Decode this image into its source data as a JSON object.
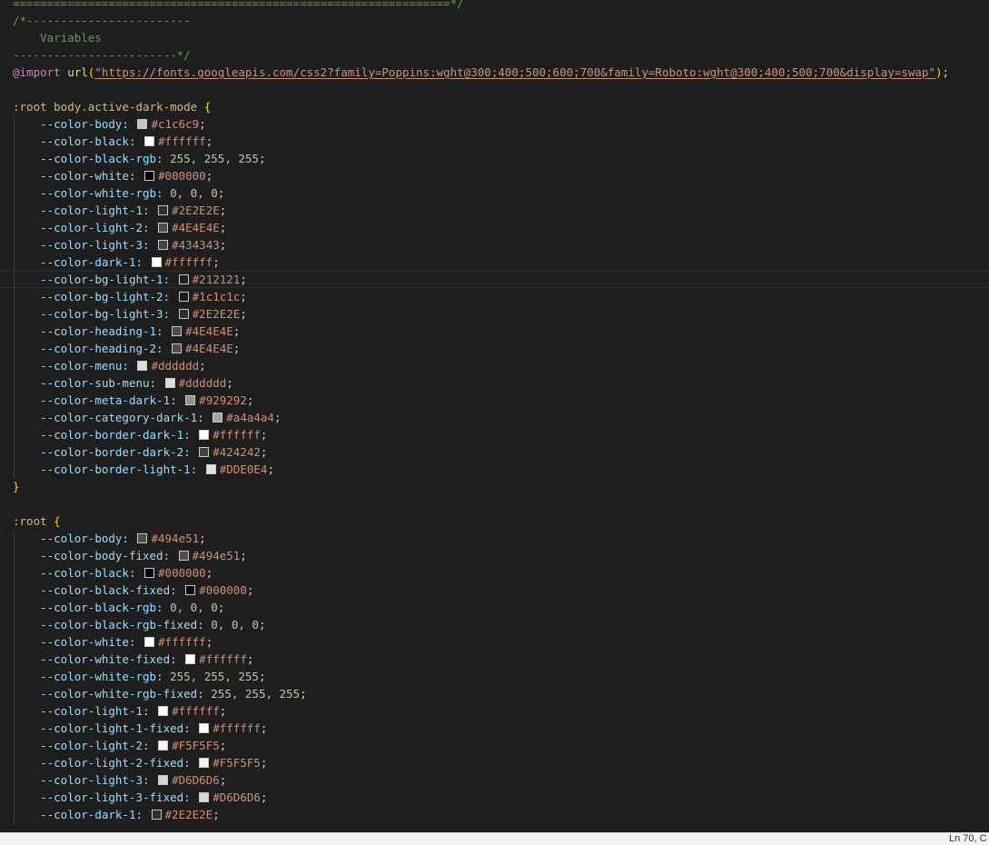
{
  "editor": {
    "lines": [
      {
        "type": "comment",
        "text": "================================================================*/"
      },
      {
        "type": "comment",
        "text": "/*------------------------"
      },
      {
        "type": "comment",
        "text": "    Variables"
      },
      {
        "type": "comment",
        "text": "------------------------*/"
      },
      {
        "type": "import",
        "keyword": "@import",
        "func": "url",
        "url": "\"https://fonts.googleapis.com/css2?family=Poppins:wght@300;400;500;600;700&family=Roboto:wght@300;400;500;700&display=swap\""
      },
      {
        "type": "blank"
      },
      {
        "type": "selector",
        "text": ":root body.active-dark-mode"
      },
      {
        "type": "decl",
        "prop": "--color-body",
        "kind": "color",
        "value": "#c1c6c9",
        "swatch": "#c1c6c9"
      },
      {
        "type": "decl",
        "prop": "--color-black",
        "kind": "color",
        "value": "#ffffff",
        "swatch": "#ffffff"
      },
      {
        "type": "decl",
        "prop": "--color-black-rgb",
        "kind": "number",
        "value": "255, 255, 255"
      },
      {
        "type": "decl",
        "prop": "--color-white",
        "kind": "color",
        "value": "#000000",
        "swatch": "#000000"
      },
      {
        "type": "decl",
        "prop": "--color-white-rgb",
        "kind": "number",
        "value": "0, 0, 0"
      },
      {
        "type": "decl",
        "prop": "--color-light-1",
        "kind": "color",
        "value": "#2E2E2E",
        "swatch": "#2E2E2E"
      },
      {
        "type": "decl",
        "prop": "--color-light-2",
        "kind": "color",
        "value": "#4E4E4E",
        "swatch": "#4E4E4E"
      },
      {
        "type": "decl",
        "prop": "--color-light-3",
        "kind": "color",
        "value": "#434343",
        "swatch": "#434343"
      },
      {
        "type": "decl",
        "prop": "--color-dark-1",
        "kind": "color",
        "value": "#ffffff",
        "swatch": "#ffffff"
      },
      {
        "type": "decl",
        "prop": "--color-bg-light-1",
        "kind": "color",
        "value": "#212121",
        "swatch": "#212121",
        "current": true
      },
      {
        "type": "decl",
        "prop": "--color-bg-light-2",
        "kind": "color",
        "value": "#1c1c1c",
        "swatch": "#1c1c1c"
      },
      {
        "type": "decl",
        "prop": "--color-bg-light-3",
        "kind": "color",
        "value": "#2E2E2E",
        "swatch": "#2E2E2E"
      },
      {
        "type": "decl",
        "prop": "--color-heading-1",
        "kind": "color",
        "value": "#4E4E4E",
        "swatch": "#4E4E4E"
      },
      {
        "type": "decl",
        "prop": "--color-heading-2",
        "kind": "color",
        "value": "#4E4E4E",
        "swatch": "#4E4E4E"
      },
      {
        "type": "decl",
        "prop": "--color-menu",
        "kind": "color",
        "value": "#dddddd",
        "swatch": "#dddddd"
      },
      {
        "type": "decl",
        "prop": "--color-sub-menu",
        "kind": "color",
        "value": "#dddddd",
        "swatch": "#dddddd"
      },
      {
        "type": "decl",
        "prop": "--color-meta-dark-1",
        "kind": "color",
        "value": "#929292",
        "swatch": "#929292"
      },
      {
        "type": "decl",
        "prop": "--color-category-dark-1",
        "kind": "color",
        "value": "#a4a4a4",
        "swatch": "#a4a4a4"
      },
      {
        "type": "decl",
        "prop": "--color-border-dark-1",
        "kind": "color",
        "value": "#ffffff",
        "swatch": "#ffffff"
      },
      {
        "type": "decl",
        "prop": "--color-border-dark-2",
        "kind": "color",
        "value": "#424242",
        "swatch": "#424242"
      },
      {
        "type": "decl",
        "prop": "--color-border-light-1",
        "kind": "color",
        "value": "#DDE0E4",
        "swatch": "#DDE0E4"
      },
      {
        "type": "close",
        "text": "}"
      },
      {
        "type": "blank"
      },
      {
        "type": "selector",
        "text": ":root"
      },
      {
        "type": "decl",
        "prop": "--color-body",
        "kind": "color",
        "value": "#494e51",
        "swatch": "#494e51"
      },
      {
        "type": "decl",
        "prop": "--color-body-fixed",
        "kind": "color",
        "value": "#494e51",
        "swatch": "#494e51"
      },
      {
        "type": "decl",
        "prop": "--color-black",
        "kind": "color",
        "value": "#000000",
        "swatch": "#000000"
      },
      {
        "type": "decl",
        "prop": "--color-black-fixed",
        "kind": "color",
        "value": "#000000",
        "swatch": "#000000"
      },
      {
        "type": "decl",
        "prop": "--color-black-rgb",
        "kind": "number",
        "value": "0, 0, 0"
      },
      {
        "type": "decl",
        "prop": "--color-black-rgb-fixed",
        "kind": "number",
        "value": "0, 0, 0"
      },
      {
        "type": "decl",
        "prop": "--color-white",
        "kind": "color",
        "value": "#ffffff",
        "swatch": "#ffffff"
      },
      {
        "type": "decl",
        "prop": "--color-white-fixed",
        "kind": "color",
        "value": "#ffffff",
        "swatch": "#ffffff"
      },
      {
        "type": "decl",
        "prop": "--color-white-rgb",
        "kind": "number",
        "value": "255, 255, 255"
      },
      {
        "type": "decl",
        "prop": "--color-white-rgb-fixed",
        "kind": "number",
        "value": "255, 255, 255"
      },
      {
        "type": "decl",
        "prop": "--color-light-1",
        "kind": "color",
        "value": "#ffffff",
        "swatch": "#ffffff"
      },
      {
        "type": "decl",
        "prop": "--color-light-1-fixed",
        "kind": "color",
        "value": "#ffffff",
        "swatch": "#ffffff"
      },
      {
        "type": "decl",
        "prop": "--color-light-2",
        "kind": "color",
        "value": "#F5F5F5",
        "swatch": "#F5F5F5"
      },
      {
        "type": "decl",
        "prop": "--color-light-2-fixed",
        "kind": "color",
        "value": "#F5F5F5",
        "swatch": "#F5F5F5"
      },
      {
        "type": "decl",
        "prop": "--color-light-3",
        "kind": "color",
        "value": "#D6D6D6",
        "swatch": "#D6D6D6"
      },
      {
        "type": "decl",
        "prop": "--color-light-3-fixed",
        "kind": "color",
        "value": "#D6D6D6",
        "swatch": "#D6D6D6"
      },
      {
        "type": "decl",
        "prop": "--color-dark-1",
        "kind": "color",
        "value": "#2E2E2E",
        "swatch": "#2E2E2E"
      }
    ]
  },
  "statusbar": {
    "position": "Ln 70, C"
  }
}
